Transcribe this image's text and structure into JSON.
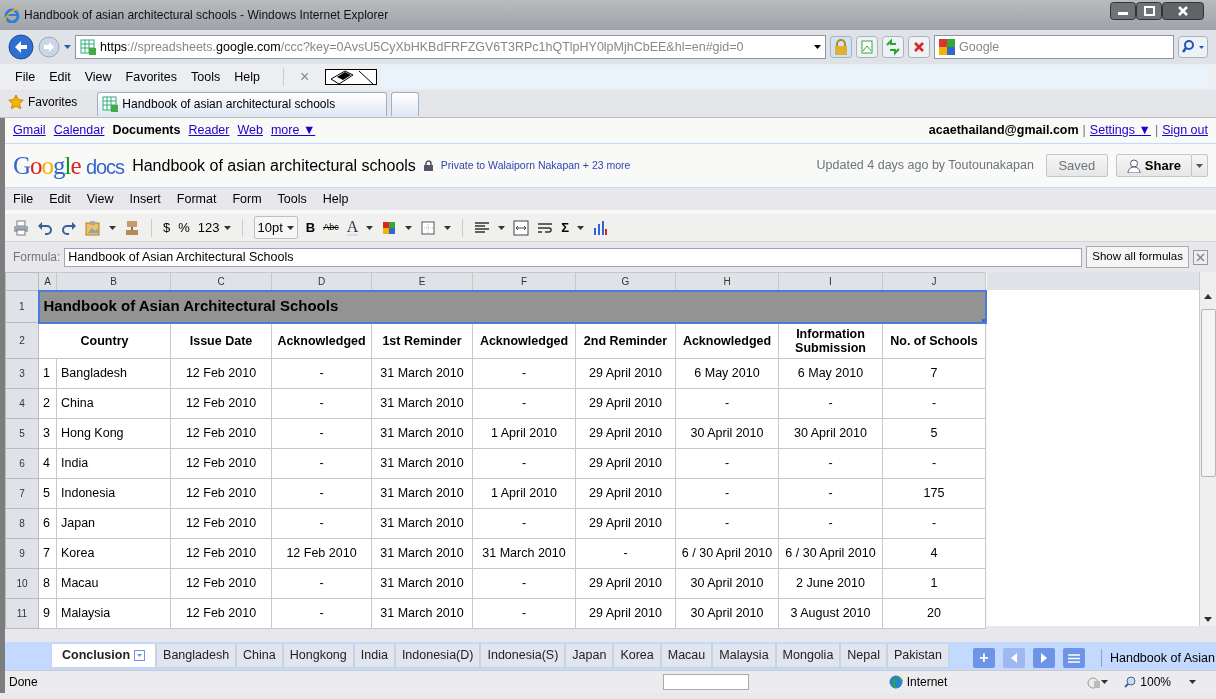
{
  "browser": {
    "title": "Handbook of asian architectural schools - Windows Internet Explorer",
    "url_parts": [
      {
        "text": "https",
        "strong": true
      },
      {
        "text": "://spreadsheets.",
        "strong": false
      },
      {
        "text": "google.com",
        "strong": true
      },
      {
        "text": "/ccc?key=0AvsU5CyXbHKBdFRFZGV6T3RPc1hQTlpHY0lpMjhCbEE&hl=en#gid=0",
        "strong": false
      }
    ],
    "search_placeholder": "Google",
    "menu": [
      "File",
      "Edit",
      "View",
      "Favorites",
      "Tools",
      "Help"
    ],
    "close_glyph": "×",
    "favorites": "Favorites",
    "tab_title": "Handbook of asian architectural schools"
  },
  "google_bar": {
    "left": [
      {
        "label": "Gmail",
        "kind": "link"
      },
      {
        "label": "Calendar",
        "kind": "link"
      },
      {
        "label": "Documents",
        "kind": "current"
      },
      {
        "label": "Reader",
        "kind": "link"
      },
      {
        "label": "Web",
        "kind": "link"
      },
      {
        "label": "more ▼",
        "kind": "link"
      }
    ],
    "right": [
      {
        "label": "acaethailand@gmail.com",
        "kind": "account"
      },
      {
        "label": "|",
        "kind": "separator"
      },
      {
        "label": "Settings ▼",
        "kind": "link"
      },
      {
        "label": "|",
        "kind": "separator"
      },
      {
        "label": "Sign out",
        "kind": "link"
      }
    ]
  },
  "docs_header": {
    "logo_word": "Google",
    "logo_product": "docs",
    "title": "Handbook of asian architectural schools",
    "sharing": "Private to Walaiporn Nakapan + 23 more",
    "updated": "Updated 4 days ago by Toutounakapan",
    "saved": "Saved",
    "share": "Share"
  },
  "menu": [
    "File",
    "Edit",
    "View",
    "Insert",
    "Format",
    "Form",
    "Tools",
    "Help"
  ],
  "toolbar": {
    "currency": "$",
    "percent": "%",
    "number_format": "123",
    "font_size": "10pt",
    "bold": "B",
    "strikethrough": "Abc",
    "text_color": "A",
    "sum": "Σ"
  },
  "formula": {
    "label": "Formula:",
    "value": "Handbook of Asian Architectural Schools",
    "button": "Show all formulas"
  },
  "sheet": {
    "columns": [
      "A",
      "B",
      "C",
      "D",
      "E",
      "F",
      "G",
      "H",
      "I",
      "J"
    ],
    "title_row": {
      "number": "1",
      "text": "Handbook of Asian Architectural Schools",
      "selected": true
    },
    "header_row": {
      "number": "2",
      "cells": [
        "Country",
        "Issue Date",
        "Acknowledged",
        "1st Reminder",
        "Acknowledged",
        "2nd Reminder",
        "Acknowledged",
        "Information Submission",
        "No. of Schools"
      ]
    },
    "rows": [
      {
        "number": "3",
        "cells": [
          "1",
          "Bangladesh",
          "12 Feb 2010",
          "-",
          "31 March 2010",
          "-",
          "29 April 2010",
          "6 May 2010",
          "6 May 2010",
          "7"
        ]
      },
      {
        "number": "4",
        "cells": [
          "2",
          "China",
          "12 Feb 2010",
          "-",
          "31 March 2010",
          "-",
          "29 April 2010",
          "-",
          "-",
          "-"
        ]
      },
      {
        "number": "5",
        "cells": [
          "3",
          "Hong Kong",
          "12 Feb 2010",
          "-",
          "31 March 2010",
          "1 April 2010",
          "29 April 2010",
          "30 April 2010",
          "30 April 2010",
          "5"
        ]
      },
      {
        "number": "6",
        "cells": [
          "4",
          "India",
          "12 Feb 2010",
          "-",
          "31 March 2010",
          "-",
          "29 April 2010",
          "-",
          "-",
          "-"
        ]
      },
      {
        "number": "7",
        "cells": [
          "5",
          "Indonesia",
          "12 Feb 2010",
          "-",
          "31 March 2010",
          "1 April 2010",
          "29 April 2010",
          "-",
          "-",
          "175"
        ]
      },
      {
        "number": "8",
        "cells": [
          "6",
          "Japan",
          "12 Feb 2010",
          "-",
          "31 March 2010",
          "-",
          "29 April 2010",
          "-",
          "-",
          "-"
        ]
      },
      {
        "number": "9",
        "cells": [
          "7",
          "Korea",
          "12 Feb 2010",
          "12 Feb 2010",
          "31 March 2010",
          "31 March 2010",
          "-",
          "6 / 30 April 2010",
          "6 / 30 April 2010",
          "4"
        ]
      },
      {
        "number": "10",
        "cells": [
          "8",
          "Macau",
          "12 Feb 2010",
          "-",
          "31 March 2010",
          "-",
          "29 April 2010",
          "30 April 2010",
          "2 June 2010",
          "1"
        ]
      },
      {
        "number": "11",
        "cells": [
          "9",
          "Malaysia",
          "12 Feb 2010",
          "-",
          "31 March 2010",
          "-",
          "29 April 2010",
          "30 April 2010",
          "3 August 2010",
          "20"
        ]
      }
    ]
  },
  "sheet_tabs": [
    {
      "label": "Conclusion",
      "selected": true
    },
    {
      "label": "Bangladesh",
      "selected": false
    },
    {
      "label": "China",
      "selected": false
    },
    {
      "label": "Hongkong",
      "selected": false
    },
    {
      "label": "India",
      "selected": false
    },
    {
      "label": "Indonesia(D)",
      "selected": false
    },
    {
      "label": "Indonesia(S)",
      "selected": false
    },
    {
      "label": "Japan",
      "selected": false
    },
    {
      "label": "Korea",
      "selected": false
    },
    {
      "label": "Macau",
      "selected": false
    },
    {
      "label": "Malaysia",
      "selected": false
    },
    {
      "label": "Mongolia",
      "selected": false
    },
    {
      "label": "Nepal",
      "selected": false
    },
    {
      "label": "Pakistan",
      "selected": false
    }
  ],
  "add_sheet": "+",
  "sheet_caption": "Handbook of Asian",
  "status_bar": {
    "text": "Done",
    "zone": "Internet",
    "zoom": "100%"
  }
}
